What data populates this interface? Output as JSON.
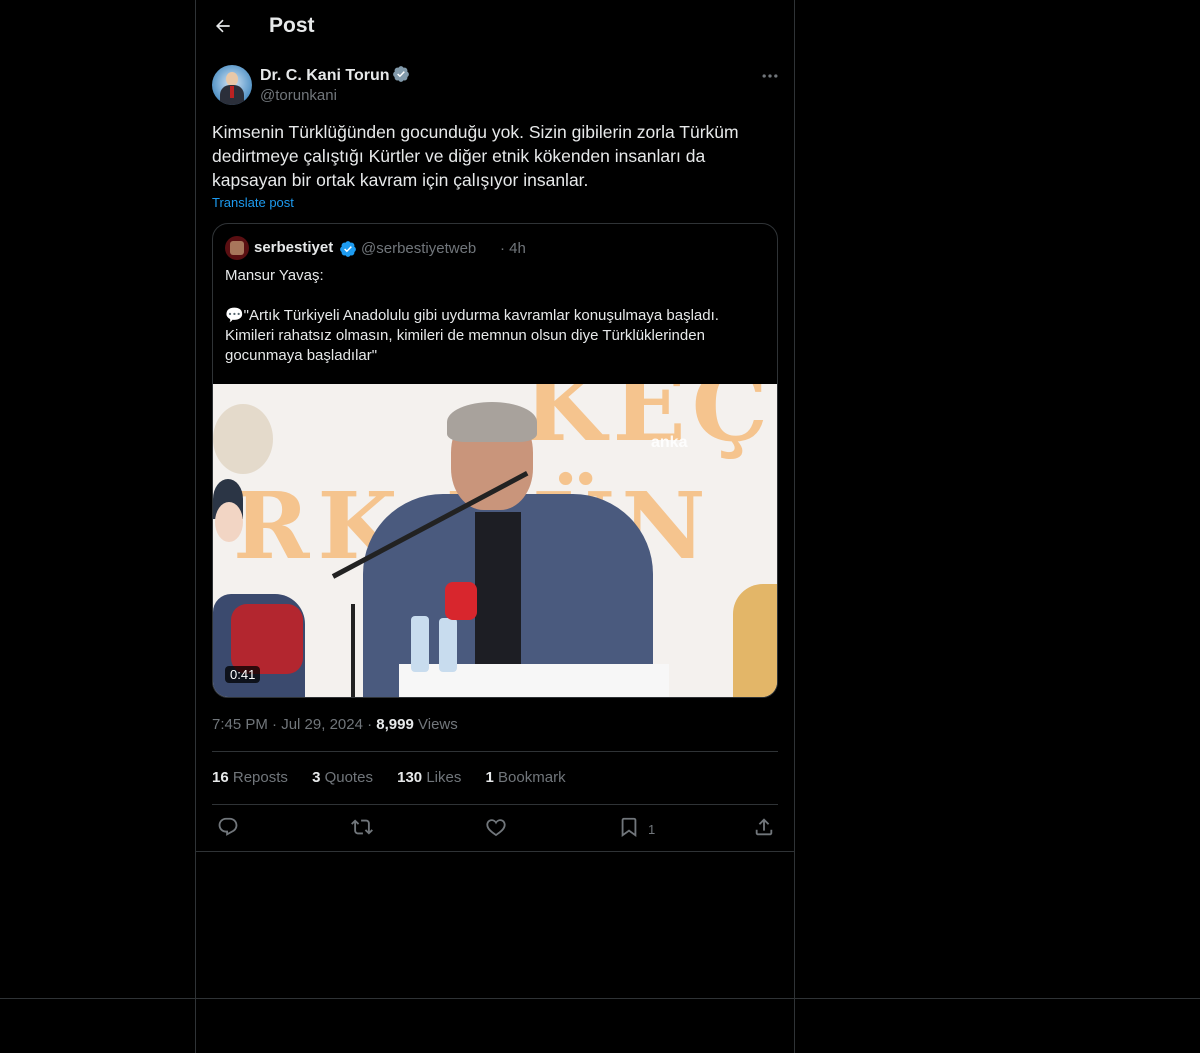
{
  "header": {
    "title": "Post"
  },
  "author": {
    "name": "Dr. C. Kani Torun",
    "handle": "@torunkani"
  },
  "post": {
    "text": "Kimsenin Türklüğünden gocunduğu yok. Sizin gibilerin zorla Türküm dedirtmeye çalıştığı Kürtler ve diğer etnik kökenden insanları da kapsayan bir ortak kavram için çalışıyor insanlar.",
    "translate_label": "Translate post"
  },
  "quote": {
    "name": "serbestiyet",
    "handle": "@serbestiyetweb",
    "time": "· 4h",
    "text": "Mansur Yavaş:\n\n💬\"Artık Türkiyeli Anadolulu gibi uydurma kavramlar konuşulmaya başladı. Kimileri rahatsız olmasın, kimileri de memnun olsun diye Türklüklerinden gocunmaya başladılar\"",
    "video": {
      "duration": "0:41",
      "watermark": "anka",
      "backdrop_text_top": "KEÇ",
      "backdrop_text_mid": "RK DÜN"
    }
  },
  "meta": {
    "time": "7:45 PM",
    "date": "Jul 29, 2024",
    "views_count": "8,999",
    "views_label": "Views",
    "dot": "·"
  },
  "stats": [
    {
      "count": "16",
      "label": "Reposts"
    },
    {
      "count": "3",
      "label": "Quotes"
    },
    {
      "count": "130",
      "label": "Likes"
    },
    {
      "count": "1",
      "label": "Bookmark"
    }
  ],
  "actions": {
    "bookmark_count": "1"
  },
  "colors": {
    "background": "#000000",
    "text": "#e7e9ea",
    "muted": "#71767b",
    "accent": "#1d9bf0",
    "border": "#2f3336"
  },
  "icons": [
    "back-arrow-icon",
    "verified-badge-icon",
    "more-icon",
    "reply-icon",
    "repost-icon",
    "like-icon",
    "bookmark-icon",
    "share-icon"
  ]
}
